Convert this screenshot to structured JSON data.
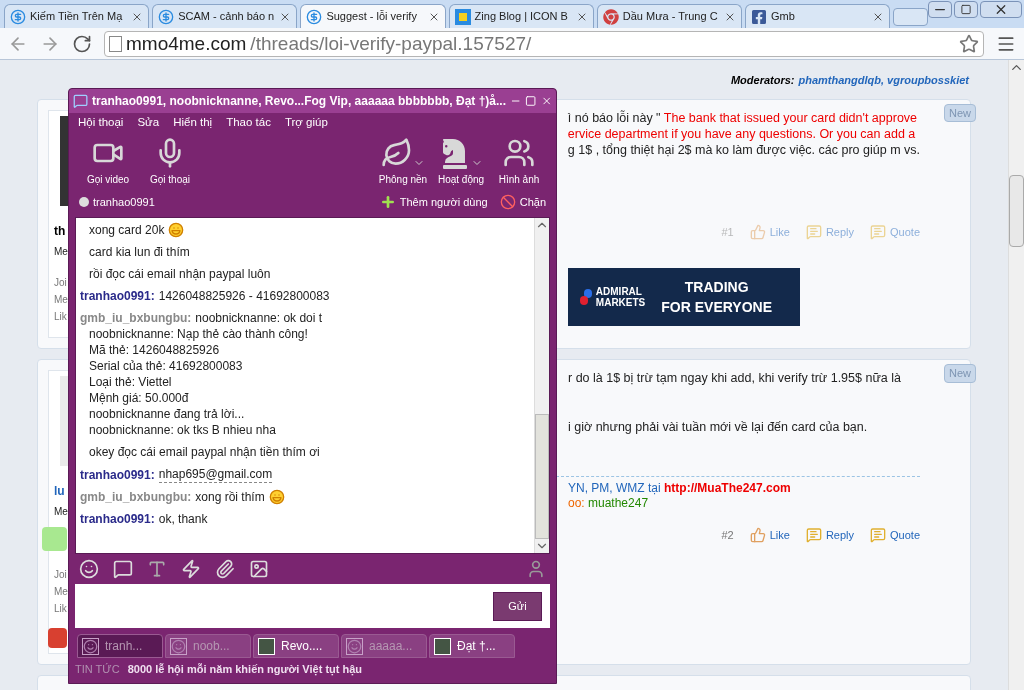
{
  "browser": {
    "tabs": [
      {
        "title": "Kiếm Tiền Trên Mạ",
        "selected": false,
        "kind": "site"
      },
      {
        "title": "SCAM - cảnh báo n",
        "selected": false,
        "kind": "site"
      },
      {
        "title": "Suggest - lỗi verify",
        "selected": true,
        "kind": "site"
      },
      {
        "title": "Zing Blog | ICON B",
        "selected": false,
        "kind": "zing"
      },
      {
        "title": "Dầu Mưa - Trung C",
        "selected": false,
        "kind": "chrome"
      },
      {
        "title": "Gmb",
        "selected": false,
        "kind": "facebook"
      }
    ],
    "url": {
      "domain": "mmo4me.com",
      "path": "/threads/loi-verify-paypal.157527/"
    }
  },
  "forum": {
    "moderators": {
      "label": "Moderators:",
      "names": "phamthangdlqb, vgroupbosskiet"
    },
    "posts": [
      {
        "user": {
          "name": "th",
          "rank": "Me",
          "stats": [
            "Joi",
            "Me",
            "Lik"
          ]
        },
        "badge": "New",
        "lines": [
          {
            "text": "ì nó báo lỗi này \" ",
            "highlight": "The bank that issued your card didn't approve"
          },
          {
            "highlight": "ervice department if you have any questions. Or you can add a"
          },
          {
            "text": "g 1$ , tổng thiệt hại 2$ mà ko làm được việc. các pro giúp m vs."
          }
        ],
        "number": "#1",
        "actions": [
          "Like",
          "Reply",
          "Quote"
        ],
        "faded": true,
        "ad": {
          "brand_top": "ADMIRAL",
          "brand_bottom": "MARKETS",
          "slogan_top": "TRADING",
          "slogan_bottom": "FOR EVERYONE"
        }
      },
      {
        "user": {
          "name": "lu",
          "rank": "Me",
          "stats": [
            "Joi",
            "Me",
            "Lik"
          ]
        },
        "badge": "New",
        "lines": [
          {
            "text": "r do là 1$ bị trừ tạm ngay khi add, khi verify trừ 1.95$ nữa là"
          },
          {
            "text": "i giờ nhưng phải vài tuần mới về lại đến card của bạn."
          }
        ],
        "signature": [
          {
            "text": "YN, PM, WMZ tại ",
            "link": "http://MuaThe247.com"
          },
          {
            "text": "oo: ",
            "link": "muathe247"
          }
        ],
        "number": "#2",
        "actions": [
          "Like",
          "Reply",
          "Quote"
        ],
        "faded": false
      }
    ]
  },
  "messenger": {
    "title": "tranhao0991, noobnicknanne, Revo...Fog Vip, aaaaaa bbbbbbb, Đạt †)å...",
    "menu": [
      "Hội thoại",
      "Sửa",
      "Hiển thị",
      "Thao tác",
      "Trợ giúp"
    ],
    "tools_left": [
      {
        "label": "Gọi video",
        "kind": "video"
      },
      {
        "label": "Gọi thoại",
        "kind": "mic"
      }
    ],
    "tools_right": [
      {
        "label": "Phông nền",
        "kind": "leaf",
        "dropdown": true
      },
      {
        "label": "Hoạt động",
        "kind": "chess",
        "dropdown": true
      },
      {
        "label": "Hình ảnh",
        "kind": "photos",
        "dropdown": false
      }
    ],
    "contact": "tranhao0991",
    "add_user": "Thêm người dùng",
    "block": "Chặn",
    "messages": [
      {
        "first": "xong card 20k",
        "emoticon": true
      },
      {
        "first": "card kia lun đi thím",
        "emoticon": false
      },
      {
        "first": "rồi đọc cái email nhận paypal luôn",
        "emoticon": false
      },
      {
        "sender": "tranhao0991:",
        "kind": "me",
        "first": "1426048825926 - 41692800083",
        "emoticon": false
      },
      {
        "sender": "gmb_iu_bxbungbu:",
        "kind": "other",
        "first": "noobnicknanne: ok doi t",
        "lines": [
          "noobnicknanne: Nạp thẻ cào thành công!",
          "Mã thẻ: 1426048825926",
          "Serial của thẻ: 41692800083",
          "Loại thẻ: Viettel",
          "Mệnh giá: 50.000đ",
          "noobnicknanne đang trả lời...",
          "noobnicknanne: ok tks B nhieu nha"
        ],
        "emoticon": false
      },
      {
        "first": "okey đọc cái email paypal nhận tiền thím ơi",
        "emoticon": false
      },
      {
        "sender": "tranhao0991:",
        "kind": "me",
        "first": "nhap695@gmail.com",
        "emoticon": false,
        "link": true
      },
      {
        "sender": "gmb_iu_bxbungbu:",
        "kind": "other",
        "first": "xong rồi thím",
        "emoticon": true
      },
      {
        "sender": "tranhao0991:",
        "kind": "me",
        "first": "ok, thank",
        "emoticon": false
      }
    ],
    "send": "Gửi",
    "tabs": [
      {
        "label": "tranh...",
        "selected": true,
        "online": false
      },
      {
        "label": "noob...",
        "selected": false,
        "online": false
      },
      {
        "label": "Revo....",
        "selected": false,
        "online": true
      },
      {
        "label": "aaaaa...",
        "selected": false,
        "online": false
      },
      {
        "label": "Đạt †...",
        "selected": false,
        "online": true
      }
    ],
    "news": {
      "label": "TIN TỨC",
      "headline": "8000 lễ hội mỗi năm khiến người Việt tụt hậu"
    }
  }
}
